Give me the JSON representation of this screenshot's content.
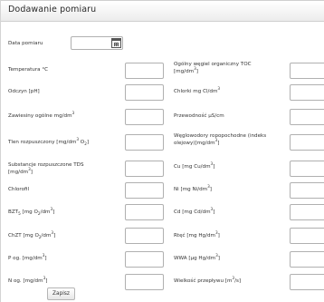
{
  "form": {
    "title": "Dodawanie pomiaru",
    "date_label": "Data pomiaru",
    "date_value": "",
    "submit_label": "Zapisz"
  },
  "left_fields": [
    {
      "label": "Temperatura °C"
    },
    {
      "label": "Odczyn [pH]"
    },
    {
      "label": "Zawiesiny ogólne mg/dm³"
    },
    {
      "label": "Tlen rozpuszczony [mg/dm³ O₂]"
    },
    {
      "label": "Substancje rozpuszczone TDS [mg/dm³]"
    },
    {
      "label": "Chlorofil"
    },
    {
      "label": "BZT₅ [mg O₂/dm³]"
    },
    {
      "label": "ChZT [mg O₂/dm³]"
    },
    {
      "label": "P og. [mg/dm³]"
    },
    {
      "label": "N og. [mg/dm³]"
    }
  ],
  "right_fields": [
    {
      "label": "Ogólny węgiel organiczny TOC [mg/dm³]"
    },
    {
      "label": "Chlorki mg Cl/dm³"
    },
    {
      "label": "Przewodność µS/cm"
    },
    {
      "label": "Węglowodory ropopochodne (indeks olejowy)[mg/dm³]"
    },
    {
      "label": "Cu [mg Cu/dm³]"
    },
    {
      "label": "Ni [mg Ni/dm³]"
    },
    {
      "label": "Cd [mg Cd/dm³]"
    },
    {
      "label": "Rtęć [mg Hg/dm³]"
    },
    {
      "label": "WWA [µg Hg/dm³]"
    },
    {
      "label": "Wielkość przepływu [m³/s]"
    }
  ]
}
